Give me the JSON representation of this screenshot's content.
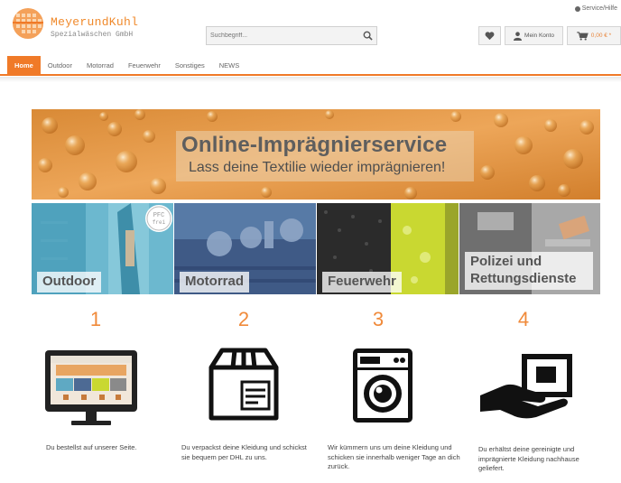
{
  "topbar": {
    "service_link": "Service/Hilfe"
  },
  "logo": {
    "name": "MeyerundKuhl",
    "subtitle": "Spezialwäschen GmbH"
  },
  "search": {
    "placeholder": "Suchbegriff..."
  },
  "header": {
    "account_label": "Mein Konto",
    "cart_total": "0,00 € *"
  },
  "nav": {
    "items": [
      "Home",
      "Outdoor",
      "Motorrad",
      "Feuerwehr",
      "Sonstiges",
      "NEWS"
    ],
    "active": "Home"
  },
  "hero": {
    "title": "Online-Imprägnierservice",
    "subtitle": "Lass deine Textilie wieder imprägnieren!"
  },
  "categories": [
    {
      "label": "Outdoor",
      "badge": "PFC frei"
    },
    {
      "label": "Motorrad"
    },
    {
      "label": "Feuerwehr"
    },
    {
      "label": "Polizei und Rettungsdienste"
    }
  ],
  "steps": [
    {
      "number": "1",
      "text": "Du bestellst auf unserer Seite."
    },
    {
      "number": "2",
      "text": "Du verpackst deine Kleidung und schickst sie bequem per DHL zu uns."
    },
    {
      "number": "3",
      "text": "Wir kümmern uns um deine Kleidung und schicken sie innerhalb weniger Tage an dich zurück."
    },
    {
      "number": "4",
      "text": "Du erhältst deine gereinigte und imprägnierte Kleidung nachhause geliefert."
    }
  ],
  "colors": {
    "accent": "#f07a28",
    "step_number": "#f08a3a"
  }
}
